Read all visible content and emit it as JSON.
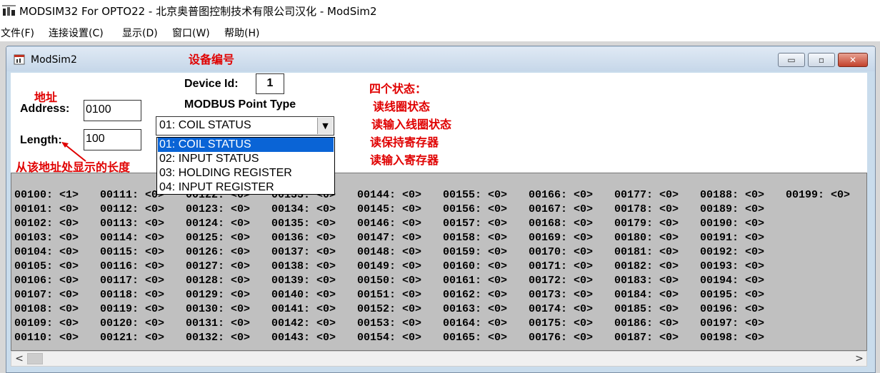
{
  "app": {
    "icon_text": "MODSIM",
    "title": "MODSIM32 For OPTO22 - 北京奥普图控制技术有限公司汉化 - ModSim2"
  },
  "menu": [
    "文件(F)",
    "连接设置(C)",
    "显示(D)",
    "窗口(W)",
    "帮助(H)"
  ],
  "child_window": {
    "title": "ModSim2",
    "buttons": {
      "minimize": "▭",
      "restore": "▫",
      "close": "✕"
    }
  },
  "form": {
    "device_id_label": "Device Id:",
    "device_id_value": "1",
    "point_type_label": "MODBUS Point Type",
    "address_label": "Address:",
    "address_value": "0100",
    "length_label": "Length:",
    "length_value": "100",
    "combo_value": "01: COIL STATUS",
    "combo_arrow": "▼",
    "options": [
      {
        "label": "01: COIL STATUS",
        "selected": true
      },
      {
        "label": "02: INPUT STATUS",
        "selected": false
      },
      {
        "label": "03: HOLDING REGISTER",
        "selected": false
      },
      {
        "label": "04: INPUT REGISTER",
        "selected": false
      }
    ]
  },
  "annotations": {
    "device_no": "设备编号",
    "address": "地址",
    "length": "从该地址处显示的长度",
    "states_title": "四个状态：",
    "state1": "读线圈状态",
    "state2": "读输入线圈状态",
    "state3": "读保持寄存器",
    "state4": "读输入寄存器"
  },
  "grid": {
    "columns": [
      [
        "00100: <1>",
        "00101: <0>",
        "00102: <0>",
        "00103: <0>",
        "00104: <0>",
        "00105: <0>",
        "00106: <0>",
        "00107: <0>",
        "00108: <0>",
        "00109: <0>",
        "00110: <0>"
      ],
      [
        "00111: <0>",
        "00112: <0>",
        "00113: <0>",
        "00114: <0>",
        "00115: <0>",
        "00116: <0>",
        "00117: <0>",
        "00118: <0>",
        "00119: <0>",
        "00120: <0>",
        "00121: <0>"
      ],
      [
        "00122: <0>",
        "00123: <0>",
        "00124: <0>",
        "00125: <0>",
        "00126: <0>",
        "00127: <0>",
        "00128: <0>",
        "00129: <0>",
        "00130: <0>",
        "00131: <0>",
        "00132: <0>"
      ],
      [
        "00133: <0>",
        "00134: <0>",
        "00135: <0>",
        "00136: <0>",
        "00137: <0>",
        "00138: <0>",
        "00139: <0>",
        "00140: <0>",
        "00141: <0>",
        "00142: <0>",
        "00143: <0>"
      ],
      [
        "00144: <0>",
        "00145: <0>",
        "00146: <0>",
        "00147: <0>",
        "00148: <0>",
        "00149: <0>",
        "00150: <0>",
        "00151: <0>",
        "00152: <0>",
        "00153: <0>",
        "00154: <0>"
      ],
      [
        "00155: <0>",
        "00156: <0>",
        "00157: <0>",
        "00158: <0>",
        "00159: <0>",
        "00160: <0>",
        "00161: <0>",
        "00162: <0>",
        "00163: <0>",
        "00164: <0>",
        "00165: <0>"
      ],
      [
        "00166: <0>",
        "00167: <0>",
        "00168: <0>",
        "00169: <0>",
        "00170: <0>",
        "00171: <0>",
        "00172: <0>",
        "00173: <0>",
        "00174: <0>",
        "00175: <0>",
        "00176: <0>"
      ],
      [
        "00177: <0>",
        "00178: <0>",
        "00179: <0>",
        "00180: <0>",
        "00181: <0>",
        "00182: <0>",
        "00183: <0>",
        "00184: <0>",
        "00185: <0>",
        "00186: <0>",
        "00187: <0>"
      ],
      [
        "00188: <0>",
        "00189: <0>",
        "00190: <0>",
        "00191: <0>",
        "00192: <0>",
        "00193: <0>",
        "00194: <0>",
        "00195: <0>",
        "00196: <0>",
        "00197: <0>",
        "00198: <0>"
      ],
      [
        "00199: <0>"
      ]
    ]
  },
  "scrollbar": {
    "left_arrow": "<",
    "right_arrow": ">"
  },
  "colors": {
    "annotation": "#e00000",
    "selection": "#0a64d6",
    "grid_bg": "#c0c0c0"
  }
}
